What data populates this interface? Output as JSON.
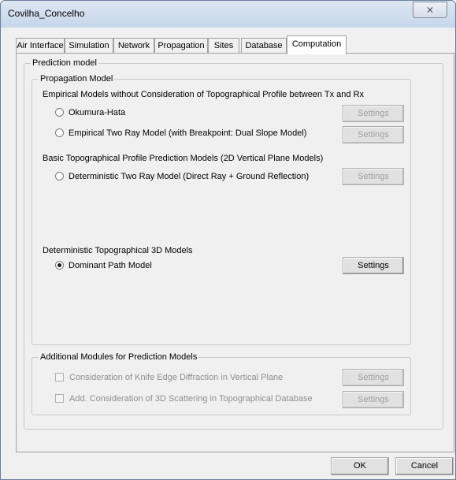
{
  "window": {
    "title": "Covilha_Concelho",
    "close_glyph": "⨯"
  },
  "tabs": [
    {
      "label": "Air Interface"
    },
    {
      "label": "Simulation"
    },
    {
      "label": "Network"
    },
    {
      "label": "Propagation"
    },
    {
      "label": "Sites"
    },
    {
      "label": "Database"
    },
    {
      "label": "Computation",
      "active": true
    }
  ],
  "prediction_model": {
    "label": "Prediction model",
    "propagation_model": {
      "label": "Propagation Model",
      "empirical_heading": "Empirical Models without Consideration of Topographical Profile between Tx and Rx",
      "okumura_hata": "Okumura-Hata",
      "empirical_two_ray": "Empirical Two Ray Model (with Breakpoint: Dual Slope Model)",
      "basic_heading": "Basic Topographical Profile Prediction Models (2D Vertical Plane Models)",
      "deterministic_two_ray": "Deterministic Two Ray Model (Direct Ray + Ground Reflection)",
      "deterministic_3d_heading": "Deterministic Topographical 3D Models",
      "dominant_path": "Dominant Path Model",
      "selected": "Dominant Path Model"
    },
    "additional_modules": {
      "label": "Additional Modules for Prediction Models",
      "knife_edge": "Consideration of Knife Edge Diffraction in Vertical Plane",
      "scattering": "Add. Consideration of 3D Scattering in Topographical Database"
    },
    "settings_label": "Settings"
  },
  "footer": {
    "ok_label": "OK",
    "cancel_label": "Cancel"
  }
}
